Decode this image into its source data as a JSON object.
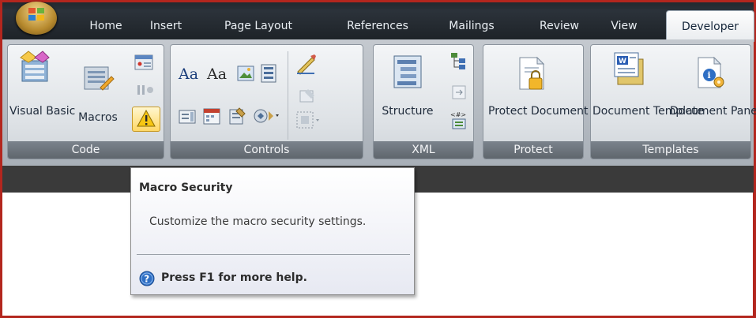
{
  "tabs": [
    "Home",
    "Insert",
    "Page Layout",
    "References",
    "Mailings",
    "Review",
    "View",
    "Developer"
  ],
  "active_tab": "Developer",
  "groups": {
    "code": {
      "label": "Code",
      "visual_basic": "Visual Basic",
      "macros": "Macros"
    },
    "controls": {
      "label": "Controls",
      "aa1": "Aa",
      "aa2": "Aa"
    },
    "xml": {
      "label": "XML",
      "structure": "Structure"
    },
    "protect": {
      "label": "Protect",
      "protect_document": "Protect Document"
    },
    "templates": {
      "label": "Templates",
      "document_template": "Document Template",
      "document_panel": "Document Panel"
    }
  },
  "tooltip": {
    "title": "Macro Security",
    "description": "Customize the macro security settings.",
    "help": "Press F1 for more help."
  },
  "colors": {
    "frame": "#b3261e",
    "ribbon_dark": "#2c333b",
    "group_label_bg": "#6b737b",
    "tooltip_bg": "#ffffff",
    "help_icon": "#2f6fc4"
  },
  "icons": [
    "office-button",
    "visual-basic-icon",
    "macros-icon",
    "record-macro-icon",
    "pause-recording-icon",
    "macro-security-warning-icon",
    "design-mode-icon",
    "properties-icon",
    "group-icon",
    "structure-icon",
    "schema-icon",
    "transformation-icon",
    "expansion-packs-icon",
    "protect-document-icon",
    "document-template-icon",
    "document-panel-icon",
    "help-icon"
  ]
}
